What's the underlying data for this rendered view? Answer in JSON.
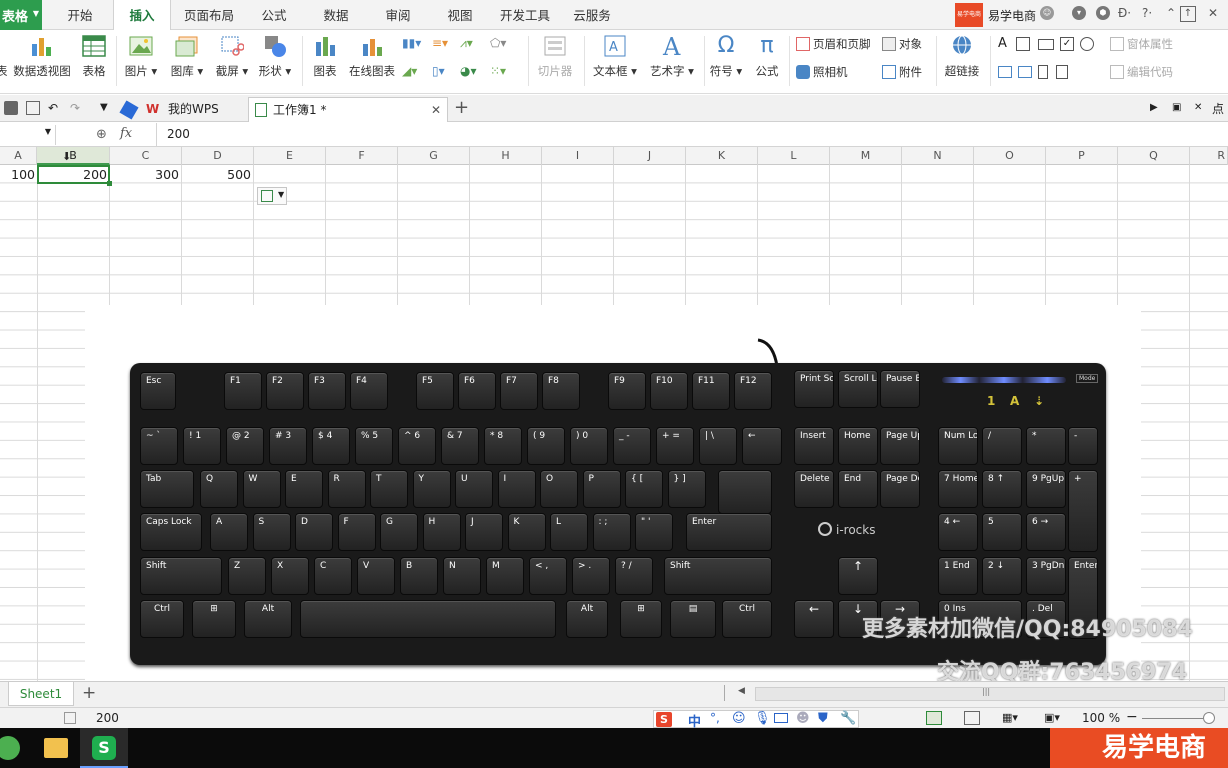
{
  "app": {
    "button_label": "表格"
  },
  "menu": {
    "tabs": [
      "开始",
      "插入",
      "页面布局",
      "公式",
      "数据",
      "审阅",
      "视图",
      "开发工具",
      "云服务"
    ],
    "active": "插入"
  },
  "brand": {
    "logo_text": "易学电商",
    "name": "易学电商"
  },
  "ribbon": {
    "pivot": "数据透视图",
    "table": "表格",
    "picture": "图片",
    "gallery": "图库",
    "screenshot": "截屏",
    "shapes": "形状",
    "chart": "图表",
    "online_chart": "在线图表",
    "slicer": "切片器",
    "textbox": "文本框",
    "wordart": "艺术字",
    "symbol": "符号",
    "formula": "公式",
    "header_footer": "页眉和页脚",
    "object": "对象",
    "camera": "照相机",
    "attachment": "附件",
    "hyperlink": "超链接",
    "window_props": "窗体属性",
    "edit_code": "编辑代码"
  },
  "tabs": [
    {
      "label": "我的WPS"
    },
    {
      "label": "工作簿1 *"
    }
  ],
  "formula_bar": {
    "fx": "fx",
    "value": "200"
  },
  "columns": [
    "A",
    "B",
    "C",
    "D",
    "E",
    "F",
    "G",
    "H",
    "I",
    "J",
    "K",
    "L",
    "M",
    "N",
    "O",
    "P",
    "Q",
    "R"
  ],
  "cells": {
    "a1": "100",
    "b1": "200",
    "c1": "300",
    "d1": "500"
  },
  "keyboard": {
    "brand": "i-rocks",
    "mode": "Mode",
    "lock_lights": [
      "1",
      "A",
      "⇣"
    ],
    "fn_row": [
      "Esc",
      "F1",
      "F2",
      "F3",
      "F4",
      "F5",
      "F6",
      "F7",
      "F8",
      "F9",
      "F10",
      "F11",
      "F12"
    ],
    "sys_keys": [
      "Print Screen",
      "Scroll Lock",
      "Pause Break"
    ],
    "nav_keys": [
      "Insert",
      "Home",
      "Page Up",
      "Delete",
      "End",
      "Page Down"
    ],
    "num_row": [
      "~ `",
      "! 1",
      "@ 2",
      "# 3",
      "$ 4",
      "% 5",
      "^ 6",
      "& 7",
      "* 8",
      "( 9",
      ") 0",
      "_ -",
      "+ =",
      "| \\",
      "←"
    ],
    "q_row": [
      "Tab",
      "Q",
      "W",
      "E",
      "R",
      "T",
      "Y",
      "U",
      "I",
      "O",
      "P",
      "{ [",
      "} ]"
    ],
    "a_row": [
      "Caps Lock",
      "A",
      "S",
      "D",
      "F",
      "G",
      "H",
      "J",
      "K",
      "L",
      ": ;",
      "\" '",
      "Enter"
    ],
    "z_row": [
      "Shift",
      "Z",
      "X",
      "C",
      "V",
      "B",
      "N",
      "M",
      "< ,",
      "> .",
      "? /",
      "Shift"
    ],
    "bottom_row": [
      "Ctrl",
      "⊞",
      "Alt",
      "",
      "Alt",
      "⊞",
      "▤",
      "Ctrl"
    ],
    "arrows": [
      "↑",
      "←",
      "↓",
      "→"
    ],
    "numpad": [
      "Num Lock",
      "/",
      "*",
      "-",
      "7 Home",
      "8 ↑",
      "9 PgUp",
      "+",
      "4 ←",
      "5",
      "6 →",
      "1 End",
      "2 ↓",
      "3 PgDn",
      "Enter",
      "0 Ins",
      ". Del"
    ]
  },
  "watermark": {
    "line1": "更多素材加微信/QQ:84905084",
    "line2": "交流QQ群:763456974"
  },
  "sheet": {
    "name": "Sheet1",
    "add": "+"
  },
  "status": {
    "value": "200",
    "zoom": "100 %"
  },
  "ime": {
    "lang": "中"
  },
  "taskbar": {
    "brand": "易学电商"
  }
}
